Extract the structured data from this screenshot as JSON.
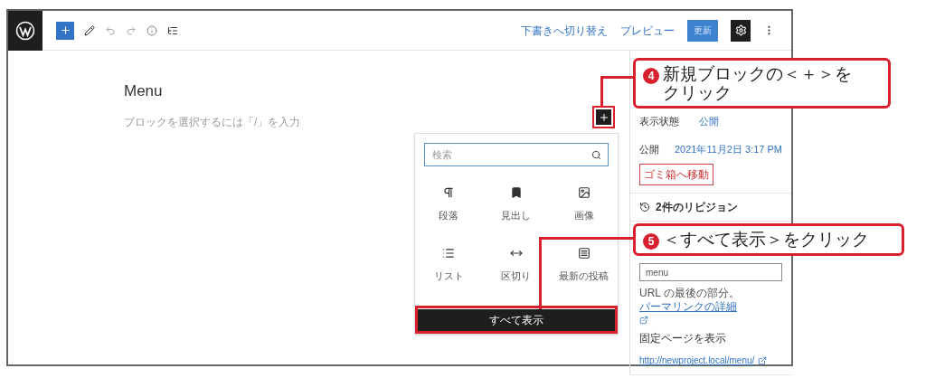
{
  "toolbar": {
    "links": [
      {
        "label": "下書きへ切り替え"
      },
      {
        "label": "プレビュー"
      }
    ],
    "primary_button": "更新",
    "settings_selected": true
  },
  "editor": {
    "title": "Menu",
    "placeholder": "ブロックを選択するには「/」を入力"
  },
  "inserter": {
    "search_placeholder": "検索",
    "blocks": [
      {
        "kind": "paragraph",
        "label": "段落"
      },
      {
        "kind": "heading",
        "label": "見出し"
      },
      {
        "kind": "image",
        "label": "画像"
      },
      {
        "kind": "list",
        "label": "リスト"
      },
      {
        "kind": "separator",
        "label": "区切り"
      },
      {
        "kind": "latest-posts",
        "label": "最新の投稿"
      }
    ],
    "browse_all": "すべて表示"
  },
  "sidebar": {
    "rows": [
      {
        "label": "表示状態",
        "value": "公開"
      },
      {
        "label": "公開",
        "value": "2021年11月2日 3:17 PM"
      }
    ],
    "trash_button": "ゴミ箱へ移動",
    "revisions": "2件のリビジョン",
    "url_slug": "menu",
    "url_help": "URL の最後の部分。",
    "permalink_link": "パーマリンクの詳細",
    "view_page_label": "固定ページを表示",
    "page_url": "http://newproject.local/menu/"
  },
  "callouts": [
    {
      "number": "4",
      "text": "新規ブロックの＜＋＞をクリック"
    },
    {
      "number": "5",
      "text": "＜すべて表示＞をクリック"
    }
  ]
}
